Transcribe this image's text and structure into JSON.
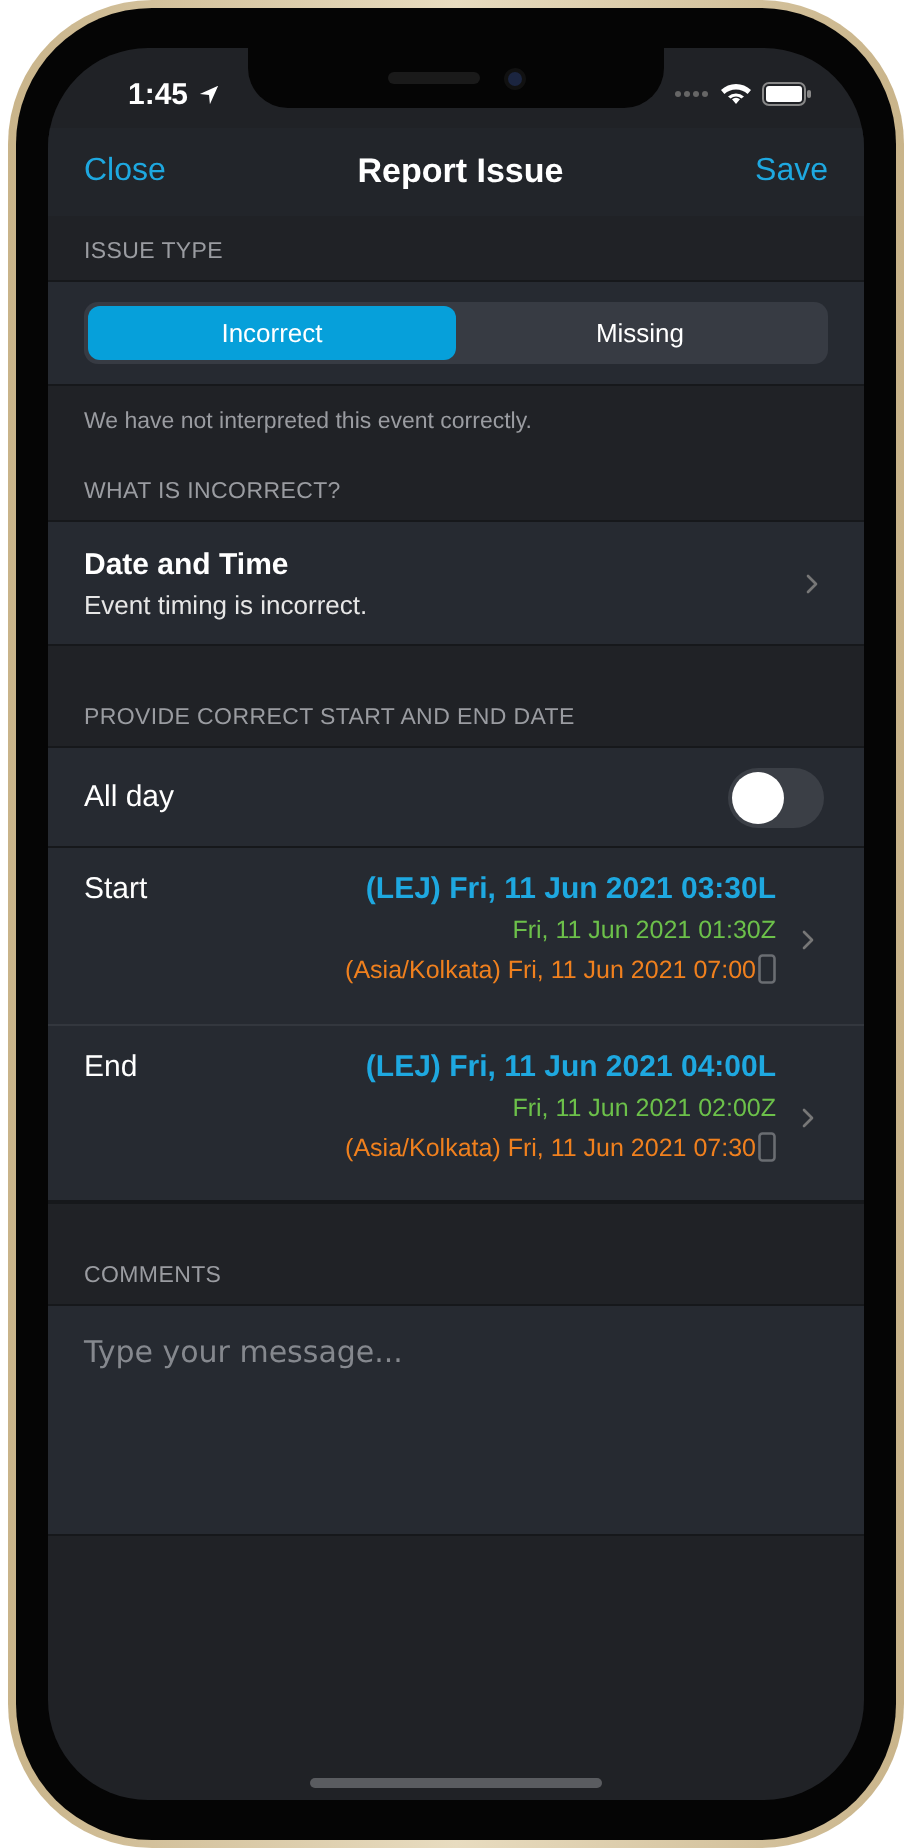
{
  "status_bar": {
    "time": "1:45"
  },
  "nav": {
    "close": "Close",
    "title": "Report Issue",
    "save": "Save"
  },
  "issue_type": {
    "header": "ISSUE TYPE",
    "segments": [
      {
        "label": "Incorrect",
        "selected": true
      },
      {
        "label": "Missing",
        "selected": false
      }
    ],
    "note": "We have not interpreted this event correctly."
  },
  "what_incorrect": {
    "header": "WHAT IS INCORRECT?",
    "title": "Date and Time",
    "subtitle": "Event timing is incorrect."
  },
  "dates": {
    "header": "PROVIDE CORRECT START AND END DATE",
    "all_day": {
      "label": "All day",
      "on": false
    },
    "rows": [
      {
        "label": "Start",
        "local": "(LEJ) Fri, 11 Jun 2021 03:30L",
        "utc": "Fri, 11 Jun 2021 01:30Z",
        "device": "(Asia/Kolkata) Fri, 11 Jun 2021 07:00"
      },
      {
        "label": "End",
        "local": "(LEJ) Fri, 11 Jun 2021 04:00L",
        "utc": "Fri, 11 Jun 2021 02:00Z",
        "device": "(Asia/Kolkata) Fri, 11 Jun 2021 07:30"
      }
    ]
  },
  "comments": {
    "header": "COMMENTS",
    "placeholder": "Type your message..."
  }
}
